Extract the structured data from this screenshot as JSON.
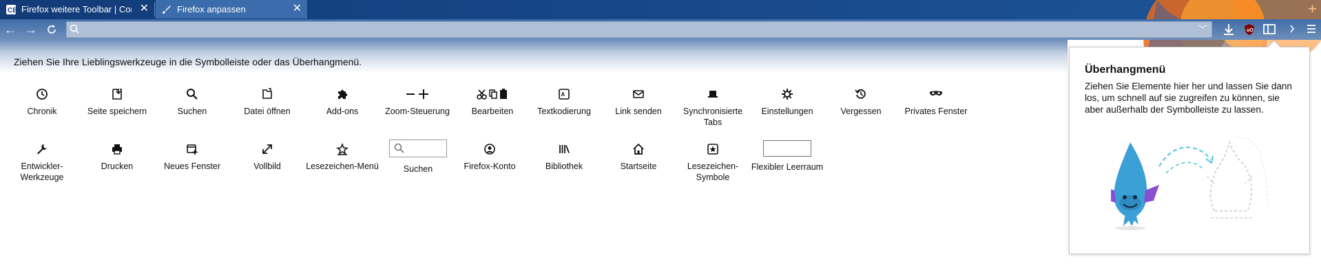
{
  "tabs": [
    {
      "title": "Firefox weitere Toolbar | Compu",
      "active": false
    },
    {
      "title": "Firefox anpassen",
      "active": true
    }
  ],
  "navbar": {
    "url_value": "",
    "url_placeholder": ""
  },
  "instruction": "Ziehen Sie Ihre Lieblingswerkzeuge in die Symbolleiste oder das Überhangmenü.",
  "palette_row1": [
    {
      "label": "Chronik",
      "icon": "clock-icon"
    },
    {
      "label": "Seite speichern",
      "icon": "save-page-icon"
    },
    {
      "label": "Suchen",
      "icon": "magnifier-icon"
    },
    {
      "label": "Datei öffnen",
      "icon": "open-file-icon"
    },
    {
      "label": "Add-ons",
      "icon": "puzzle-icon"
    },
    {
      "label": "Zoom-Steuerung",
      "icon": "zoom-controls-icon"
    },
    {
      "label": "Bearbeiten",
      "icon": "edit-controls-icon"
    },
    {
      "label": "Textkodierung",
      "icon": "text-encoding-icon"
    },
    {
      "label": "Link senden",
      "icon": "envelope-icon"
    },
    {
      "label": "Synchronisierte Tabs",
      "icon": "synced-tabs-icon"
    },
    {
      "label": "Einstellungen",
      "icon": "gear-icon"
    },
    {
      "label": "Vergessen",
      "icon": "forget-icon"
    },
    {
      "label": "Privates Fenster",
      "icon": "mask-icon"
    }
  ],
  "palette_row2": [
    {
      "label": "Entwickler-Werkzeuge",
      "icon": "wrench-icon"
    },
    {
      "label": "Drucken",
      "icon": "printer-icon"
    },
    {
      "label": "Neues Fenster",
      "icon": "new-window-icon"
    },
    {
      "label": "Vollbild",
      "icon": "fullscreen-icon"
    },
    {
      "label": "Lesezeichen-Menü",
      "icon": "bookmarks-menu-icon"
    },
    {
      "label": "Suchen",
      "icon": "search-box"
    },
    {
      "label": "Firefox-Konto",
      "icon": "account-icon"
    },
    {
      "label": "Bibliothek",
      "icon": "library-icon"
    },
    {
      "label": "Startseite",
      "icon": "home-icon"
    },
    {
      "label": "Lesezeichen-Symbole",
      "icon": "bookmarks-toolbar-icon"
    },
    {
      "label": "Flexibler Leerraum",
      "icon": "flexible-space"
    }
  ],
  "overflow_panel": {
    "title": "Überhangmenü",
    "description": "Ziehen Sie Elemente hier her und lassen Sie dann los, um schnell auf sie zugreifen zu können, sie aber außerhalb der Symbolleiste zu lassen."
  }
}
